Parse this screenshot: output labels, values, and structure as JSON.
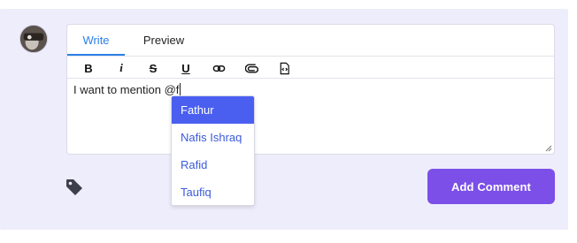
{
  "tabs": {
    "write": "Write",
    "preview": "Preview"
  },
  "toolbar": {
    "bold": "B",
    "italic": "i",
    "strike": "S",
    "underline": "U",
    "link_icon": "link-icon",
    "attach_icon": "attachment-icon",
    "code_icon": "code-file-icon"
  },
  "editor": {
    "text": "I want to mention @f"
  },
  "mentions": {
    "items": [
      "Fathur",
      "Nafis Ishraq",
      "Rafid",
      "Taufiq"
    ],
    "active_index": 0
  },
  "actions": {
    "add_comment": "Add Comment",
    "tag_icon": "tag-icon"
  },
  "colors": {
    "accent_tab": "#2c7fe8",
    "mention_active_bg": "#4a5ff0",
    "mention_text": "#3b5bdb",
    "button_bg": "#7b4fe8",
    "panel_bg": "#eeedfb"
  }
}
